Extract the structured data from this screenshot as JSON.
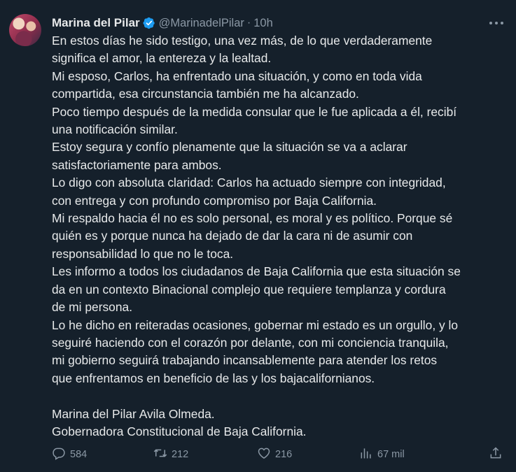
{
  "author": {
    "name": "Marina del Pilar",
    "handle": "@MarinadelPilar",
    "separator": "·",
    "time": "10h"
  },
  "icons": {
    "verified": "verified-badge-icon",
    "more": "more-horizontal-icon"
  },
  "colors": {
    "background": "#15202b",
    "text": "#e7e9ea",
    "muted": "#8b98a5",
    "verified": "#1d9bf0"
  },
  "tweet_lines": [
    "En estos días he sido testigo, una vez más, de lo que verdaderamente",
    "significa el amor, la entereza y la lealtad.",
    "Mi esposo, Carlos, ha enfrentado una situación, y como en toda vida",
    "compartida, esa circunstancia también me ha alcanzado.",
    "Poco tiempo después de la medida consular que le fue aplicada a él, recibí",
    "una notificación similar.",
    "Estoy segura  y confío plenamente que la situación se va a aclarar",
    "satisfactoriamente para ambos.",
    "Lo digo con absoluta claridad: Carlos ha actuado siempre con integridad,",
    "con entrega y con profundo compromiso por Baja California.",
    "Mi respaldo hacia él no es solo personal, es moral y es político. Porque sé",
    "quién es y porque nunca ha dejado de dar la cara ni de asumir con",
    "responsabilidad lo que no le toca.",
    "Les informo a todos los ciudadanos de Baja California que esta situación se",
    "da en un contexto Binacional complejo que requiere templanza y cordura",
    "de mi persona.",
    "Lo he dicho en reiteradas ocasiones, gobernar mi estado es un orgullo, y lo",
    "seguiré haciendo con el corazón por delante, con mi conciencia tranquila,",
    "mi gobierno seguirá trabajando incansablemente para atender los retos",
    "que enfrentamos en beneficio de las y los bajacalifornianos.",
    "",
    "Marina del Pilar Avila Olmeda.",
    "Gobernadora Constitucional de Baja California."
  ],
  "actions": {
    "replies": {
      "icon": "reply-icon",
      "count": "584"
    },
    "reposts": {
      "icon": "repost-icon",
      "count": "212"
    },
    "likes": {
      "icon": "like-icon",
      "count": "216"
    },
    "views": {
      "icon": "views-icon",
      "count": "67 mil"
    },
    "share": {
      "icon": "share-icon"
    }
  }
}
